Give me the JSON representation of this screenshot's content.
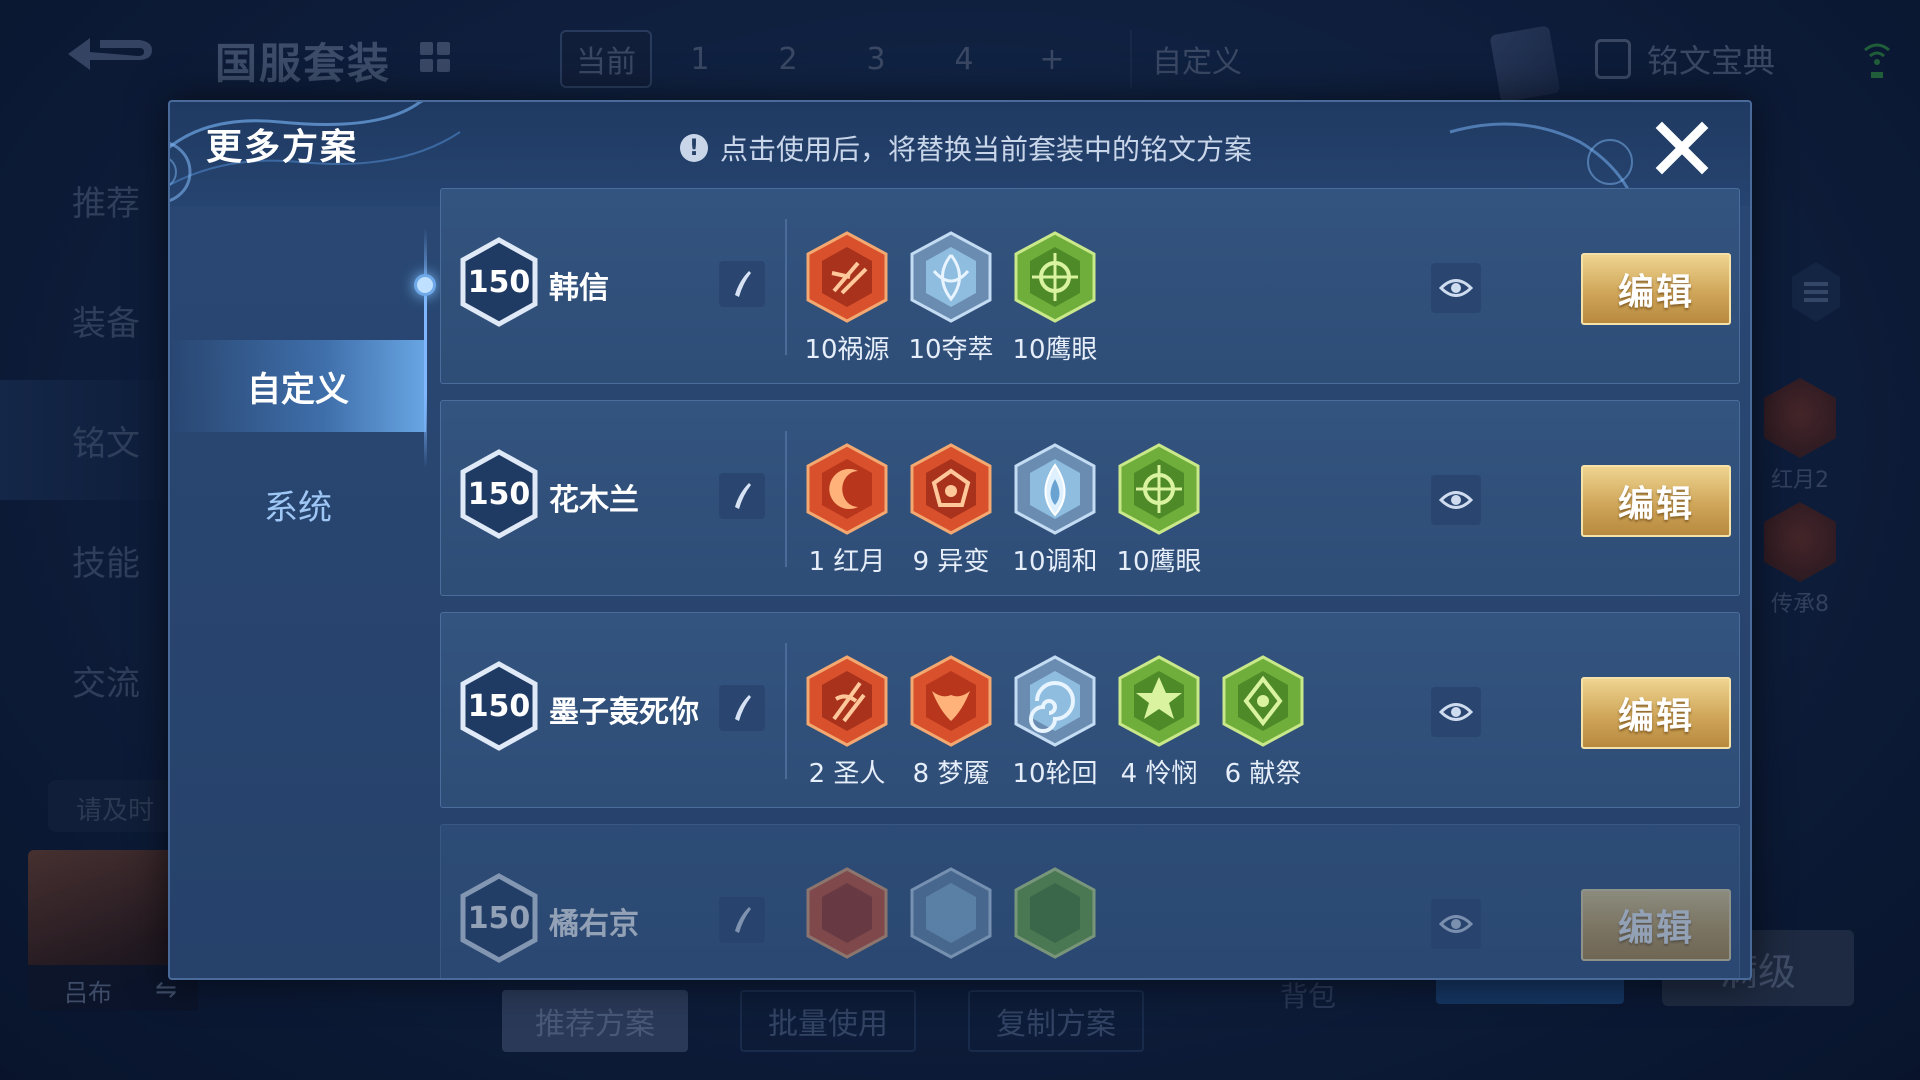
{
  "background": {
    "suite_title": "国服套装",
    "page_tabs": [
      "当前",
      "1",
      "2",
      "3",
      "4",
      "+",
      "自定义"
    ],
    "codex_label": "铭文宝典",
    "left_nav": [
      "推荐",
      "装备",
      "铭文",
      "技能",
      "交流"
    ],
    "reminder": "请及时",
    "hero_name": "吕布",
    "swap_symbol": "⇋",
    "bottom_buttons": [
      "推荐方案",
      "批量使用",
      "复制方案"
    ],
    "backpack": "背包",
    "max_level": "满级",
    "right_runes": [
      {
        "label": "红月2"
      },
      {
        "label": "传承8"
      }
    ]
  },
  "modal": {
    "title": "更多方案",
    "note_icon": "!",
    "note": "点击使用后，将替换当前套装中的铭文方案",
    "side_tabs": [
      "自定义",
      "系统"
    ],
    "edit_label": "编辑",
    "plans": [
      {
        "level": "150",
        "name": "韩信",
        "runes": [
          {
            "count_label": "10祸源",
            "color": "red",
            "icon": "rune-huoyuan-icon"
          },
          {
            "count_label": "10夺萃",
            "color": "blue",
            "icon": "rune-duocui-icon"
          },
          {
            "count_label": "10鹰眼",
            "color": "green",
            "icon": "rune-yingyan-icon"
          }
        ]
      },
      {
        "level": "150",
        "name": "花木兰",
        "runes": [
          {
            "count_label": "1 红月",
            "color": "red",
            "icon": "rune-hongyue-icon"
          },
          {
            "count_label": "9 异变",
            "color": "red",
            "icon": "rune-yibian-icon"
          },
          {
            "count_label": "10调和",
            "color": "blue",
            "icon": "rune-tiaohe-icon"
          },
          {
            "count_label": "10鹰眼",
            "color": "green",
            "icon": "rune-yingyan-icon"
          }
        ]
      },
      {
        "level": "150",
        "name": "墨子轰死你",
        "runes": [
          {
            "count_label": "2 圣人",
            "color": "red",
            "icon": "rune-shengren-icon"
          },
          {
            "count_label": "8 梦魇",
            "color": "red",
            "icon": "rune-mengyan-icon"
          },
          {
            "count_label": "10轮回",
            "color": "blue",
            "icon": "rune-lunhui-icon"
          },
          {
            "count_label": "4 怜悯",
            "color": "green",
            "icon": "rune-lianmin-icon"
          },
          {
            "count_label": "6 献祭",
            "color": "green",
            "icon": "rune-xianji-icon"
          }
        ]
      },
      {
        "level": "150",
        "name": "橘右京",
        "runes": [
          {
            "count_label": "",
            "color": "red",
            "icon": "rune-red-icon"
          },
          {
            "count_label": "",
            "color": "blue",
            "icon": "rune-blue-icon"
          },
          {
            "count_label": "",
            "color": "green",
            "icon": "rune-green-icon"
          }
        ]
      }
    ]
  },
  "colors": {
    "modal_bg": "#2a4874",
    "card_bg": "#33547f",
    "edit_gold": "#cfa65a",
    "rune_red": "#d8502c",
    "rune_blue": "#6fa8d4",
    "rune_green": "#6fae3b"
  }
}
